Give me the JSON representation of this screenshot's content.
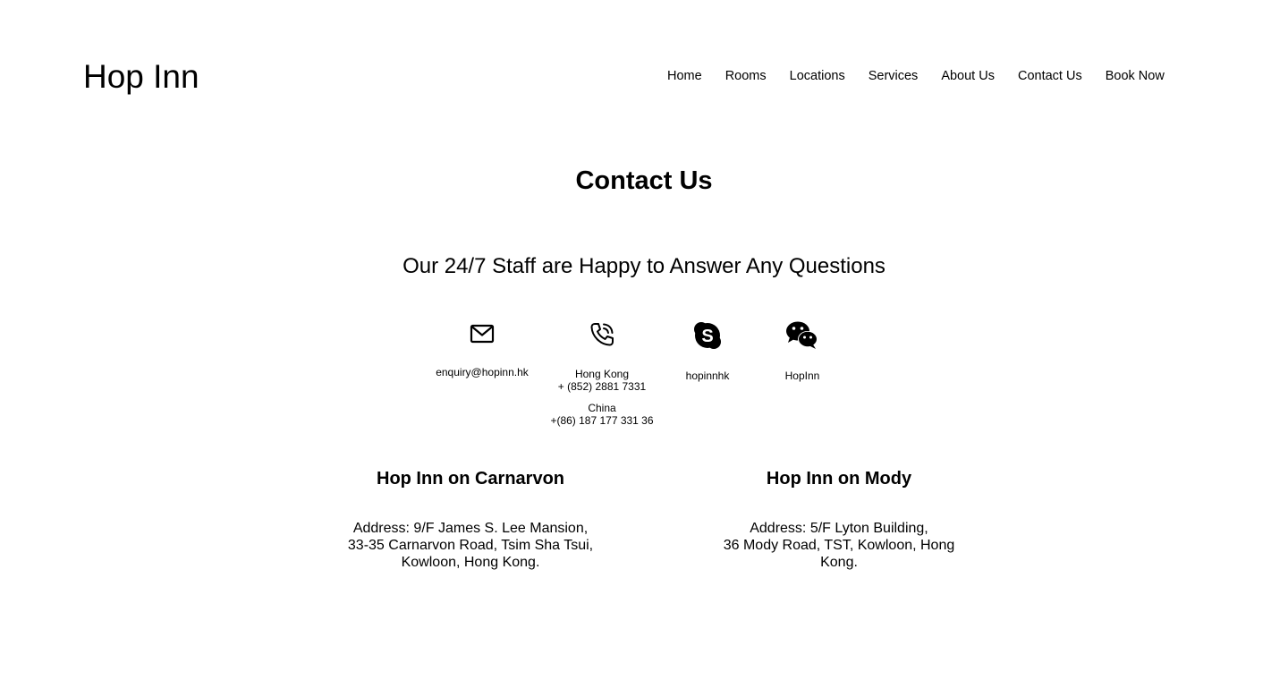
{
  "header": {
    "logo": "Hop Inn",
    "nav": [
      {
        "label": "Home"
      },
      {
        "label": "Rooms"
      },
      {
        "label": "Locations"
      },
      {
        "label": "Services"
      },
      {
        "label": "About Us"
      },
      {
        "label": "Contact Us"
      },
      {
        "label": "Book Now"
      }
    ]
  },
  "main": {
    "title": "Contact Us",
    "subtitle": "Our 24/7 Staff are Happy to Answer Any Questions",
    "contacts": {
      "email": {
        "icon": "mail-icon",
        "text": "enquiry@hopinn.hk"
      },
      "phone": {
        "icon": "phone-icon",
        "hk_label": "Hong Kong",
        "hk_number": "+ (852) 2881 7331",
        "cn_label": "China",
        "cn_number": "+(86) 187 177 331 36"
      },
      "skype": {
        "icon": "skype-icon",
        "text": "hopinnhk"
      },
      "wechat": {
        "icon": "wechat-icon",
        "text": "HopInn"
      }
    },
    "locations": [
      {
        "name": "Hop Inn on Carnarvon",
        "address_lines": [
          "Address: 9/F James S. Lee Mansion,",
          "33-35 Carnarvon Road, Tsim Sha Tsui,",
          "Kowloon, Hong Kong."
        ]
      },
      {
        "name": "Hop Inn on Mody",
        "address_lines": [
          "Address: 5/F Lyton Building,",
          "36 Mody Road, TST, Kowloon, Hong",
          "Kong."
        ]
      }
    ]
  }
}
